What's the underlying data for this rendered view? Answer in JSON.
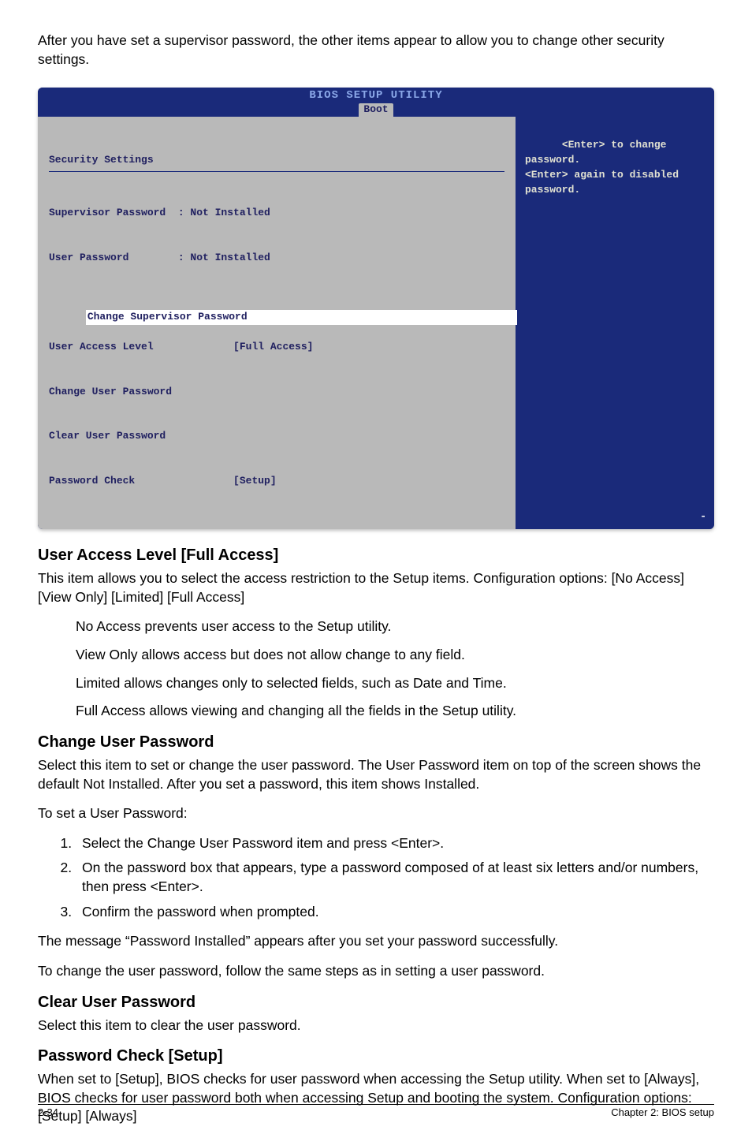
{
  "intro": "After you have set a supervisor password, the other items appear to allow you to change other security settings.",
  "bios": {
    "title_top": "BIOS SETUP UTILITY",
    "tab": "Boot",
    "left": {
      "heading": "Security Settings",
      "rows": {
        "supervisor": "Supervisor Password  : Not Installed",
        "user": "User Password        : Not Installed",
        "change_super": "Change Supervisor Password",
        "access": "User Access Level             [Full Access]",
        "change_user": "Change User Password",
        "clear_user": "Clear User Password",
        "pw_check": "Password Check                [Setup]"
      }
    },
    "right": "<Enter> to change password.\n<Enter> again to disabled password.",
    "dash": "-"
  },
  "s1": {
    "heading": "User Access Level [Full Access]",
    "p1": "This item allows you to select the access restriction to the Setup items. Configuration options: [No Access] [View Only] [Limited] [Full Access]",
    "b1": "No Access prevents user access to the Setup utility.",
    "b2": "View Only allows access but does not allow change to any field.",
    "b3": "Limited allows changes only to selected fields, such as Date and Time.",
    "b4": "Full Access allows viewing and changing all the fields in the Setup utility."
  },
  "s2": {
    "heading": "Change User Password",
    "p1": "Select this item to set or change the user password. The User Password item on top of the screen shows the default Not Installed. After you set a password, this item shows Installed.",
    "p2": "To set a User Password:",
    "li1": "Select the Change User Password item and press <Enter>.",
    "li2": "On the password box that appears, type a password composed of at least six letters and/or numbers, then press <Enter>.",
    "li3": "Confirm the password when prompted.",
    "p3": "The message “Password Installed” appears after you set your password successfully.",
    "p4": "To change the user password, follow the same steps as in setting a user password."
  },
  "s3": {
    "heading": "Clear User Password",
    "p1": "Select this item to clear the user password."
  },
  "s4": {
    "heading": "Password Check [Setup]",
    "p1": "When set to [Setup], BIOS checks for user password when accessing the Setup utility. When set to [Always], BIOS checks for user password both when accessing Setup and booting the system. Configuration options: [Setup] [Always]"
  },
  "footer": {
    "left": "2-34",
    "right": "Chapter 2: BIOS setup"
  }
}
